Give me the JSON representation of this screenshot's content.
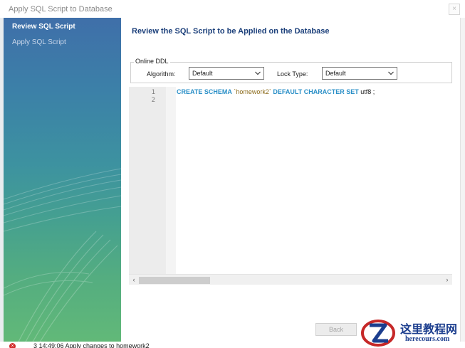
{
  "window": {
    "title": "Apply SQL Script to Database",
    "close_glyph": "×"
  },
  "sidebar": {
    "items": [
      {
        "label": "Review SQL Script",
        "active": true
      },
      {
        "label": "Apply SQL Script",
        "active": false
      }
    ]
  },
  "main": {
    "heading": "Review the SQL Script to be Applied on the Database",
    "online_ddl": {
      "legend": "Online DDL",
      "algorithm_label": "Algorithm:",
      "algorithm_value": "Default",
      "lock_type_label": "Lock Type:",
      "lock_type_value": "Default"
    },
    "editor": {
      "line_numbers": [
        "1",
        "2"
      ],
      "code": {
        "kw1": "CREATE SCHEMA",
        "schema": "`homework2`",
        "kw2": "DEFAULT CHARACTER SET",
        "charset": "utf8 ;"
      }
    }
  },
  "footer": {
    "back_label": "Back"
  },
  "statusbar": {
    "text": "3   14:49:06   Apply changes to homework2"
  },
  "watermark": {
    "brand_cn": "这里教程网",
    "brand_url": "herecours.com"
  },
  "colors": {
    "heading": "#1b3f7a",
    "keyword": "#2a8fc7",
    "string": "#8b6a1a",
    "sidebar_top": "#3f6fa9",
    "sidebar_bottom": "#62b978"
  }
}
